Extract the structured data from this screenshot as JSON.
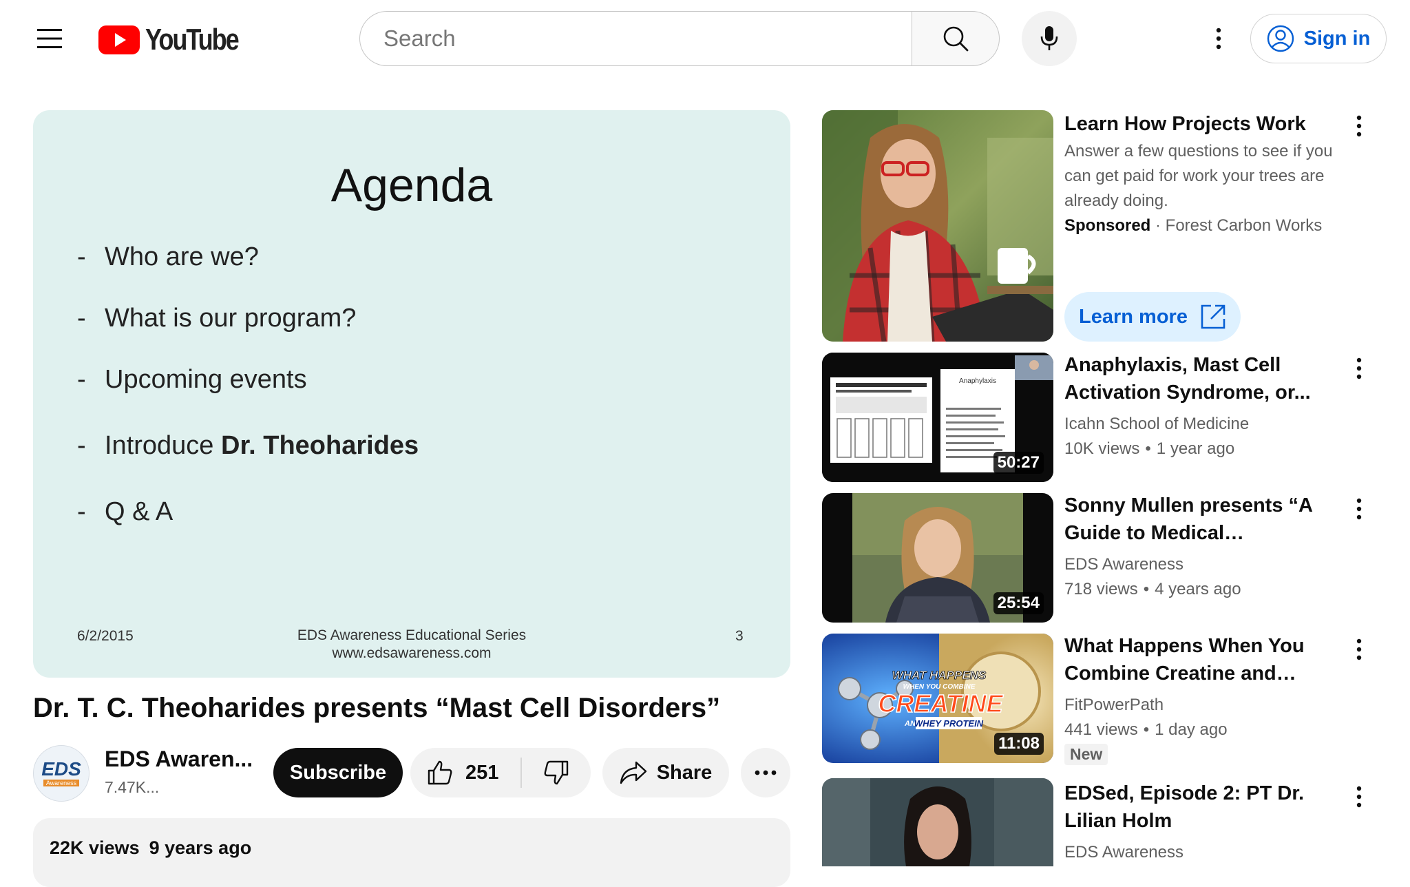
{
  "header": {
    "logo_text": "YouTube",
    "search_placeholder": "Search",
    "signin_label": "Sign in"
  },
  "player": {
    "slide_title": "Agenda",
    "items": [
      "Who are we?",
      "What is our program?",
      "Upcoming events",
      "Introduce ",
      "Q & A"
    ],
    "item_bold": "Dr. Theoharides",
    "footer_date": "6/2/2015",
    "footer_series": "EDS Awareness Educational Series",
    "footer_url": "www.edsawareness.com",
    "footer_page": "3"
  },
  "video": {
    "title": "Dr. T. C. Theoharides presents “Mast Cell Disorders”",
    "channel_name": "EDS Awaren...",
    "channel_subs": "7.47K...",
    "channel_avatar_text": "EDS",
    "channel_avatar_sub": "Awareness",
    "subscribe_label": "Subscribe",
    "like_count": "251",
    "share_label": "Share",
    "views": "22K views",
    "age": "9 years ago"
  },
  "sidebar": {
    "ad": {
      "title": "Learn How Projects Work",
      "description": "Answer a few questions to see if you can get paid for work your trees are already doing.",
      "sponsored_label": "Sponsored",
      "advertiser": "Forest Carbon Works",
      "cta_label": "Learn more"
    },
    "videos": [
      {
        "title": "Anaphylaxis, Mast Cell Activation Syndrome, or...",
        "channel": "Icahn School of Medicine",
        "views": "10K views",
        "age": "1 year ago",
        "duration": "50:27",
        "badge": ""
      },
      {
        "title": "Sonny Mullen presents “A Guide to Medical Fundraising”",
        "channel": "EDS Awareness",
        "views": "718 views",
        "age": "4 years ago",
        "duration": "25:54",
        "badge": ""
      },
      {
        "title": "What Happens When You Combine Creatine and Whey...",
        "channel": "FitPowerPath",
        "views": "441 views",
        "age": "1 day ago",
        "duration": "11:08",
        "badge": "New"
      },
      {
        "title": "EDSed, Episode 2: PT Dr. Lilian Holm",
        "channel": "EDS Awareness",
        "views": "",
        "age": "",
        "duration": "",
        "badge": ""
      }
    ],
    "thumb_texts": {
      "anaphylaxis_slide": "Anaphylaxis",
      "creatine_line1": "WHAT HAPPENS",
      "creatine_line2": "WHEN YOU COMBINE",
      "creatine_big": "CREATINE",
      "creatine_line3": "AND",
      "creatine_line4": "WHEY PROTEIN"
    }
  },
  "colors": {
    "brand_red": "#ff0000",
    "link_blue": "#065fd4",
    "slide_bg": "#e0f1ef"
  }
}
